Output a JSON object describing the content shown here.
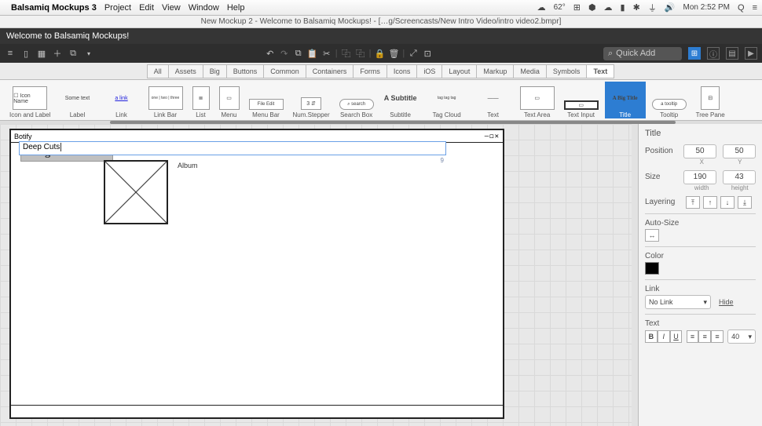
{
  "os_menu": {
    "apple_icon": "",
    "app_name": "Balsamiq Mockups 3",
    "items": [
      "Project",
      "Edit",
      "View",
      "Window",
      "Help"
    ],
    "right": {
      "temp": "62°",
      "clock": "Mon 2:52 PM"
    }
  },
  "doc_path": "New Mockup 2 - Welcome to Balsamiq Mockups! - […g/Screencasts/New Intro Video/intro video2.bmpr]",
  "titlebar": "Welcome to Balsamiq Mockups!",
  "toolbar": {
    "quick_add_placeholder": "Quick Add"
  },
  "library_tabs": [
    "All",
    "Assets",
    "Big",
    "Buttons",
    "Common",
    "Containers",
    "Forms",
    "Icons",
    "iOS",
    "Layout",
    "Markup",
    "Media",
    "Symbols",
    "Text"
  ],
  "library_active_tab": "Text",
  "palette": [
    {
      "name": "Icon and Label",
      "thumb": "☐ Icon Name"
    },
    {
      "name": "Label",
      "thumb": "Some text"
    },
    {
      "name": "Link",
      "thumb": "a link"
    },
    {
      "name": "Link Bar",
      "thumb": "one | two | three"
    },
    {
      "name": "List",
      "thumb": "≣"
    },
    {
      "name": "Menu",
      "thumb": "▭"
    },
    {
      "name": "Menu Bar",
      "thumb": "File Edit"
    },
    {
      "name": "Num.Stepper",
      "thumb": "3 ⇵"
    },
    {
      "name": "Search Box",
      "thumb": "⌕ search"
    },
    {
      "name": "Subtitle",
      "thumb": "A Subtitle"
    },
    {
      "name": "Tag Cloud",
      "thumb": "tag tag tag"
    },
    {
      "name": "Text",
      "thumb": "——"
    },
    {
      "name": "Text Area",
      "thumb": "▭"
    },
    {
      "name": "Text Input",
      "thumb": "▭"
    },
    {
      "name": "Title",
      "thumb": "A Big Title"
    },
    {
      "name": "Tooltip",
      "thumb": "a tooltip"
    },
    {
      "name": "Tree Pane",
      "thumb": "⊟"
    }
  ],
  "palette_selected": "Title",
  "mockup": {
    "window_title": "Botify",
    "window_controls": "–◻✕",
    "title_widget_text": "A Big Title",
    "editing_text": "Deep Cuts",
    "char_count": "9",
    "label_widget": "Album"
  },
  "inspector": {
    "heading": "Title",
    "position_label": "Position",
    "position": {
      "x": "50",
      "y": "50",
      "xl": "X",
      "yl": "Y"
    },
    "size_label": "Size",
    "size": {
      "w": "190",
      "h": "43",
      "wl": "width",
      "hl": "height"
    },
    "layering_label": "Layering",
    "autosize_label": "Auto-Size",
    "color_label": "Color",
    "link_label": "Link",
    "link_value": "No Link",
    "hide": "Hide",
    "text_label": "Text",
    "font_size": "40"
  }
}
